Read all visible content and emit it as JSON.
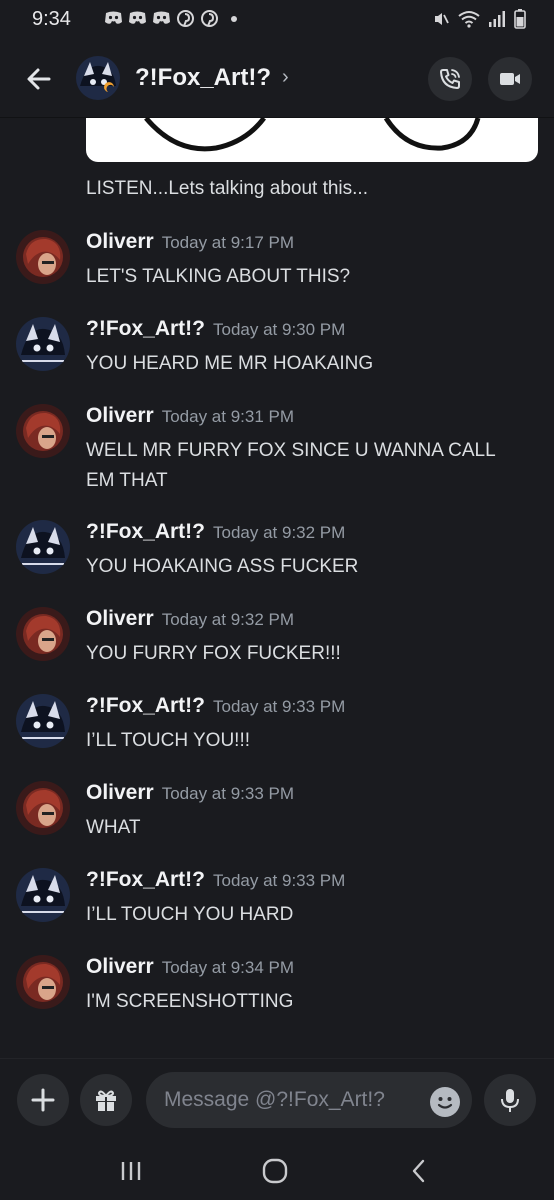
{
  "status_bar": {
    "time": "9:34",
    "notification_icons": [
      "discord-icon",
      "discord-icon",
      "discord-icon",
      "pinterest-icon",
      "pinterest-icon",
      "dot-icon"
    ],
    "right_icons": [
      "mute-icon",
      "wifi-icon",
      "signal-icon",
      "battery-icon"
    ]
  },
  "header": {
    "title": "?!Fox_Art!?",
    "chevron": "›"
  },
  "attachment": {
    "caption": "LISTEN...Lets talking about this..."
  },
  "messages": [
    {
      "author": "Oliverr",
      "time": "Today at 9:17 PM",
      "text": "LET'S TALKING ABOUT THIS?"
    },
    {
      "author": "?!Fox_Art!?",
      "time": "Today at 9:30 PM",
      "text": "YOU HEARD ME MR HOAKAING"
    },
    {
      "author": "Oliverr",
      "time": "Today at 9:31 PM",
      "text": "WELL MR FURRY FOX SINCE U WANNA CALL EM THAT"
    },
    {
      "author": "?!Fox_Art!?",
      "time": "Today at 9:32 PM",
      "text": "YOU HOAKAING ASS FUCKER"
    },
    {
      "author": "Oliverr",
      "time": "Today at 9:32 PM",
      "text": "YOU FURRY FOX FUCKER!!!"
    },
    {
      "author": "?!Fox_Art!?",
      "time": "Today at 9:33 PM",
      "text": "I’LL TOUCH YOU!!!"
    },
    {
      "author": "Oliverr",
      "time": "Today at 9:33 PM",
      "text": "WHAT"
    },
    {
      "author": "?!Fox_Art!?",
      "time": "Today at 9:33 PM",
      "text": "I’LL TOUCH YOU HARD"
    },
    {
      "author": "Oliverr",
      "time": "Today at 9:34 PM",
      "text": "I'M SCREENSHOTTING"
    }
  ],
  "composer": {
    "placeholder": "Message @?!Fox_Art!?"
  },
  "colors": {
    "background": "#1a1b1f",
    "surface": "#2b2d31",
    "text_primary": "#f2f3f5",
    "text_muted": "#949ba4"
  }
}
